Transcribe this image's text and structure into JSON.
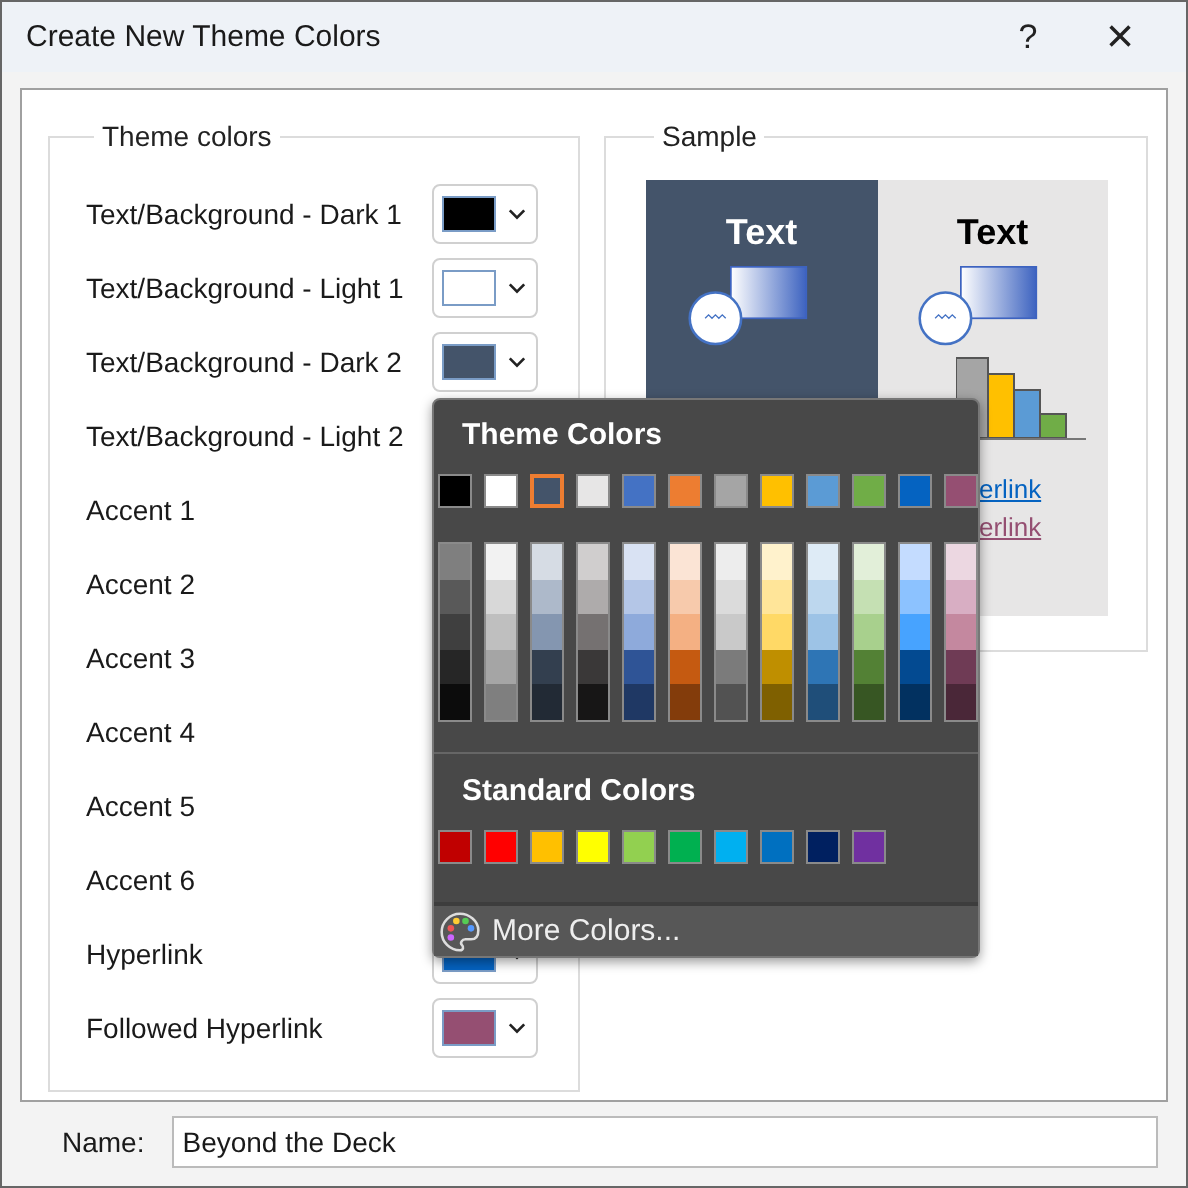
{
  "window": {
    "title": "Create New Theme Colors",
    "help": "?",
    "close": "×"
  },
  "theme_colors": {
    "title": "Theme colors",
    "rows": [
      {
        "label": "Text/Background - Dark 1",
        "color": "#000000"
      },
      {
        "label": "Text/Background - Light 1",
        "color": "#ffffff"
      },
      {
        "label": "Text/Background - Dark 2",
        "color": "#44546a"
      },
      {
        "label": "Text/Background - Light 2"
      },
      {
        "label": "Accent 1"
      },
      {
        "label": "Accent 2"
      },
      {
        "label": "Accent 3"
      },
      {
        "label": "Accent 4"
      },
      {
        "label": "Accent 5"
      },
      {
        "label": "Accent 6"
      },
      {
        "label": "Hyperlink",
        "color": "#0563c1"
      },
      {
        "label": "Followed Hyperlink",
        "color": "#954f72"
      }
    ]
  },
  "sample": {
    "title": "Sample",
    "dark_text": "Text",
    "light_text": "Text",
    "hyperlink": "erlink",
    "followed_hyperlink": "erlink"
  },
  "color_menu": {
    "theme_title": "Theme Colors",
    "theme": [
      {
        "color": "#000000",
        "selected": false,
        "shades": [
          {
            "color": "#7f7f7f"
          },
          {
            "color": "#595959"
          },
          {
            "color": "#3f3f3f"
          },
          {
            "color": "#262626"
          },
          {
            "color": "#0c0c0c"
          }
        ]
      },
      {
        "color": "#ffffff",
        "selected": false,
        "shades": [
          {
            "color": "#f2f2f2"
          },
          {
            "color": "#d8d8d8"
          },
          {
            "color": "#bfbfbf"
          },
          {
            "color": "#a5a5a5"
          },
          {
            "color": "#7f7f7f"
          }
        ]
      },
      {
        "color": "#44546a",
        "selected": true,
        "shades": [
          {
            "color": "#d6dce4"
          },
          {
            "color": "#adb9ca"
          },
          {
            "color": "#8496b0"
          },
          {
            "color": "#333f4f"
          },
          {
            "color": "#222a35"
          }
        ]
      },
      {
        "color": "#e7e6e6",
        "selected": false,
        "shades": [
          {
            "color": "#d0cece"
          },
          {
            "color": "#aeabab"
          },
          {
            "color": "#757171"
          },
          {
            "color": "#3a3838"
          },
          {
            "color": "#171616"
          }
        ]
      },
      {
        "color": "#4472c4",
        "selected": false,
        "shades": [
          {
            "color": "#d9e2f3"
          },
          {
            "color": "#b4c6e7"
          },
          {
            "color": "#8eaadb"
          },
          {
            "color": "#2f5496"
          },
          {
            "color": "#1f3864"
          }
        ]
      },
      {
        "color": "#ed7d31",
        "selected": false,
        "shades": [
          {
            "color": "#fbe4d5"
          },
          {
            "color": "#f7caac"
          },
          {
            "color": "#f4b083"
          },
          {
            "color": "#c55a11"
          },
          {
            "color": "#833c0b"
          }
        ]
      },
      {
        "color": "#a5a5a5",
        "selected": false,
        "shades": [
          {
            "color": "#ededed"
          },
          {
            "color": "#dbdbdb"
          },
          {
            "color": "#c9c9c9"
          },
          {
            "color": "#7b7b7b"
          },
          {
            "color": "#525252"
          }
        ]
      },
      {
        "color": "#ffc000",
        "selected": false,
        "shades": [
          {
            "color": "#fff2cc"
          },
          {
            "color": "#ffe599"
          },
          {
            "color": "#ffd966"
          },
          {
            "color": "#bf8f00"
          },
          {
            "color": "#7f6000"
          }
        ]
      },
      {
        "color": "#5b9bd5",
        "selected": false,
        "shades": [
          {
            "color": "#deebf6"
          },
          {
            "color": "#bdd7ee"
          },
          {
            "color": "#9dc3e6"
          },
          {
            "color": "#2e75b5"
          },
          {
            "color": "#1f4e79"
          }
        ]
      },
      {
        "color": "#70ad47",
        "selected": false,
        "shades": [
          {
            "color": "#e2efd9"
          },
          {
            "color": "#c5e0b3"
          },
          {
            "color": "#a8d08d"
          },
          {
            "color": "#538135"
          },
          {
            "color": "#375623"
          }
        ]
      },
      {
        "color": "#0563c1",
        "selected": false,
        "shades": [
          {
            "color": "#c4dcff"
          },
          {
            "color": "#8cc2ff"
          },
          {
            "color": "#47a3ff"
          },
          {
            "color": "#034a91"
          },
          {
            "color": "#023160"
          }
        ]
      },
      {
        "color": "#954f72",
        "selected": false,
        "shades": [
          {
            "color": "#ecd7e1"
          },
          {
            "color": "#d8aec3"
          },
          {
            "color": "#c4889f"
          },
          {
            "color": "#6f3b55"
          },
          {
            "color": "#4a2738"
          }
        ]
      }
    ],
    "standard_title": "Standard Colors",
    "standard": [
      {
        "color": "#c00000"
      },
      {
        "color": "#ff0000"
      },
      {
        "color": "#ffc000"
      },
      {
        "color": "#ffff00"
      },
      {
        "color": "#92d050"
      },
      {
        "color": "#00b050"
      },
      {
        "color": "#00b0f0"
      },
      {
        "color": "#0070c0"
      },
      {
        "color": "#002060"
      },
      {
        "color": "#7030a0"
      }
    ],
    "more": "More Colors..."
  },
  "name_field": {
    "label": "Name:",
    "value": "Beyond the Deck"
  }
}
